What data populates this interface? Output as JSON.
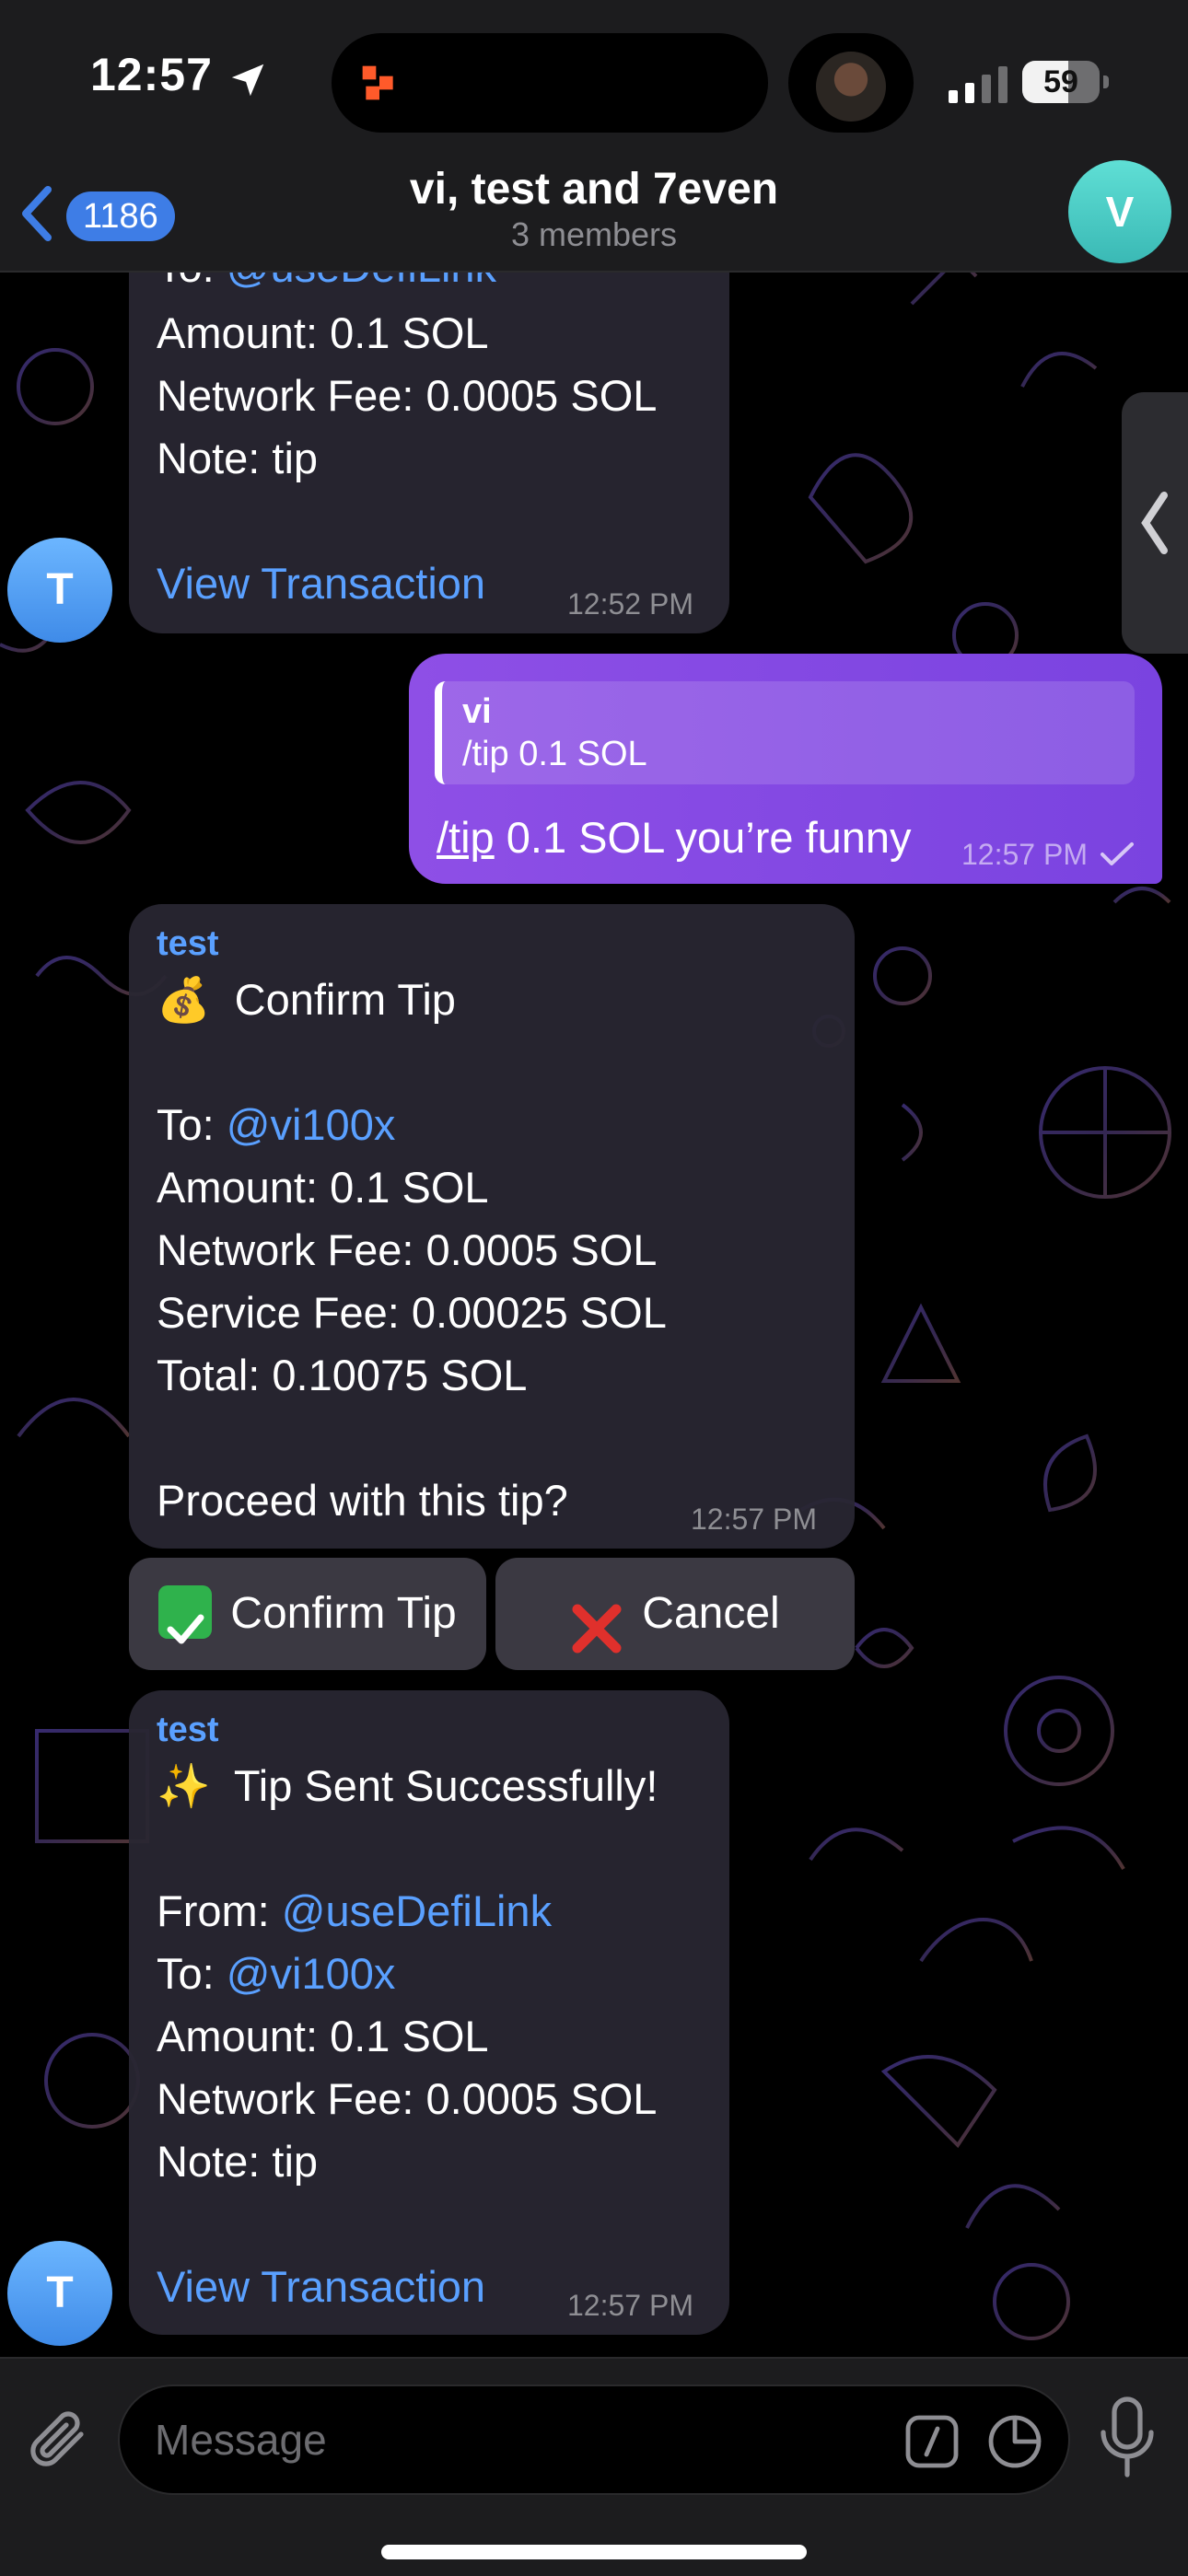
{
  "status_bar": {
    "time": "12:57",
    "battery": "59",
    "battery_level": 0.59,
    "location_icon": "location-arrow-icon",
    "signal_icon": "cellular-signal-icon"
  },
  "header": {
    "back_count": "1186",
    "title": "vi, test and 7even",
    "subtitle": "3 members",
    "avatar_letter": "V",
    "avatar_color": "#4fd0c8"
  },
  "colors": {
    "accent": "#5aa0ff",
    "outgoing_bubble": "#8a4ae4",
    "incoming_bubble": "#28262f",
    "sender_avatar": "#4a95ee"
  },
  "messages": [
    {
      "type": "incoming",
      "lines": [
        {
          "prefix": "To: ",
          "mention": "@useDefiLink"
        },
        {
          "text": "Amount: 0.1 SOL"
        },
        {
          "text": "Network Fee: 0.0005 SOL"
        },
        {
          "text": "Note: tip"
        }
      ],
      "link": "View Transaction",
      "time": "12:52 PM",
      "avatar": "T"
    },
    {
      "type": "outgoing",
      "reply": {
        "name": "vi",
        "text": "/tip 0.1 SOL"
      },
      "command": "/tip",
      "text": " 0.1 SOL you’re funny",
      "time": "12:57 PM",
      "status_icon": "read-check-icon"
    },
    {
      "type": "incoming",
      "sender": "test",
      "title_emoji": "💰",
      "title": "Confirm Tip",
      "lines": [
        {
          "prefix": "To: ",
          "mention": "@vi100x"
        },
        {
          "text": "Amount: 0.1 SOL"
        },
        {
          "text": "Network Fee: 0.0005 SOL"
        },
        {
          "text": "Service Fee: 0.00025 SOL"
        },
        {
          "text": "Total: 0.10075 SOL"
        }
      ],
      "question": "Proceed with this tip?",
      "time": "12:57 PM",
      "buttons": [
        {
          "emoji": "✅",
          "label": "Confirm Tip"
        },
        {
          "emoji": "❌",
          "label": "Cancel"
        }
      ]
    },
    {
      "type": "incoming",
      "sender": "test",
      "title_emoji": "✨",
      "title": "Tip Sent Successfully!",
      "lines": [
        {
          "prefix": "From: ",
          "mention": "@useDefiLink"
        },
        {
          "prefix": "To: ",
          "mention": "@vi100x"
        },
        {
          "text": "Amount: 0.1 SOL"
        },
        {
          "text": "Network Fee: 0.0005 SOL"
        },
        {
          "text": "Note: tip"
        }
      ],
      "link": "View Transaction",
      "time": "12:57 PM",
      "avatar": "T"
    }
  ],
  "input": {
    "placeholder": "Message"
  }
}
